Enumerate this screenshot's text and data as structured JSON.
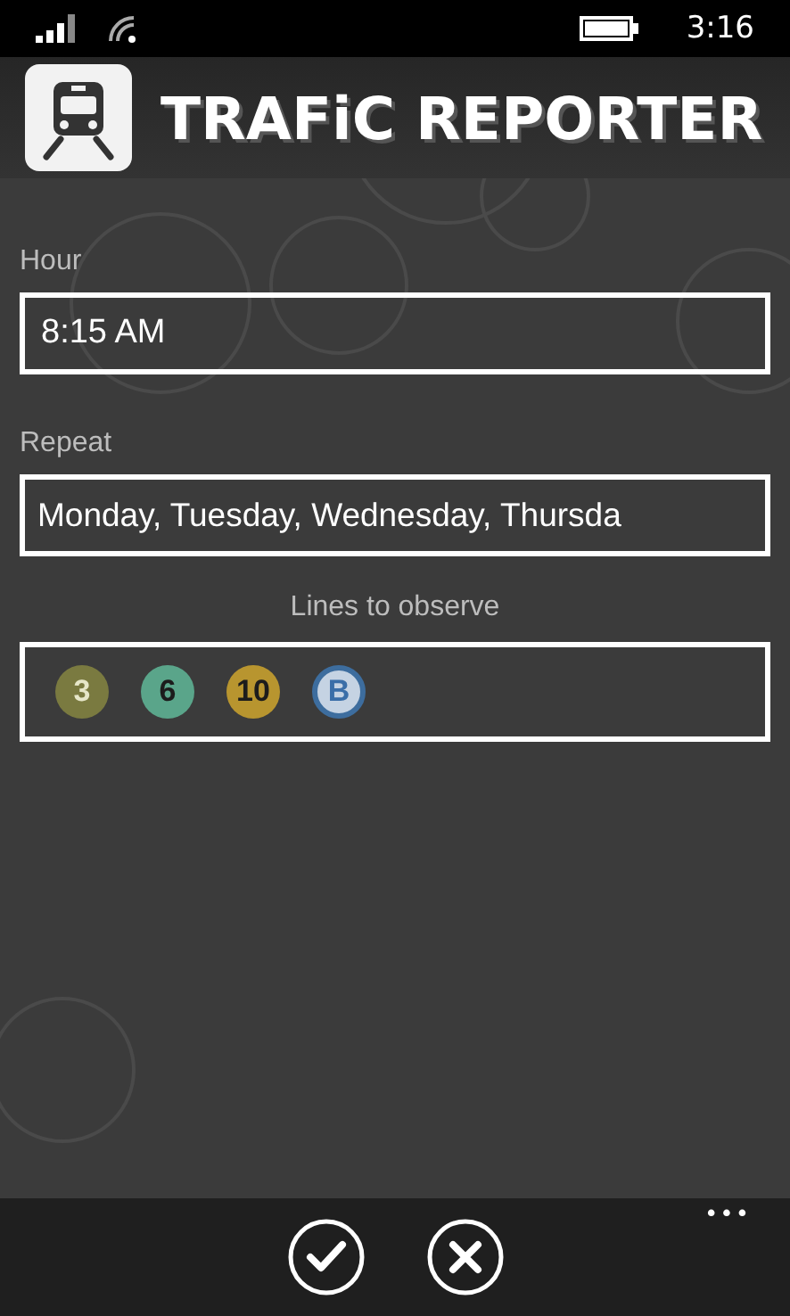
{
  "status_bar": {
    "time": "3:16"
  },
  "header": {
    "title": "TRAFiC REPORTER"
  },
  "hour": {
    "label": "Hour",
    "value": "8:15 AM"
  },
  "repeat": {
    "label": "Repeat",
    "value": "Monday, Tuesday, Wednesday, Thursda"
  },
  "lines": {
    "label": "Lines to observe",
    "items": [
      {
        "name": "3",
        "color": "#7a7a40"
      },
      {
        "name": "6",
        "color": "#5aa58a"
      },
      {
        "name": "10",
        "color": "#b8952f"
      },
      {
        "name": "B",
        "color": "#c5d3e3"
      }
    ]
  },
  "app_bar": {
    "more": "•••"
  }
}
